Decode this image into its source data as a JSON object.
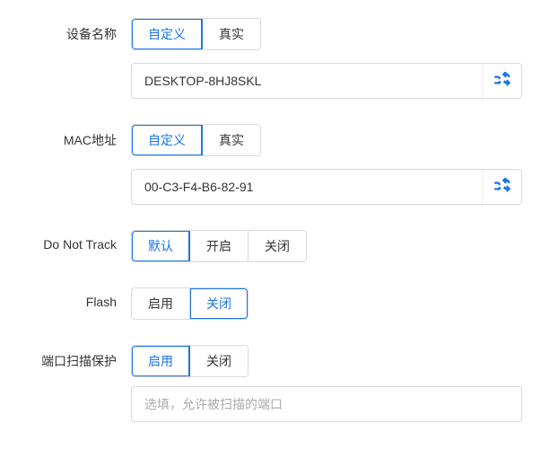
{
  "labels": {
    "device_name": "设备名称",
    "mac_address": "MAC地址",
    "dnt": "Do Not Track",
    "flash": "Flash",
    "port_scan": "端口扫描保护"
  },
  "toggles": {
    "custom": "自定义",
    "real": "真实",
    "default": "默认",
    "on": "开启",
    "off": "关闭",
    "enable": "启用",
    "disable": "关闭"
  },
  "inputs": {
    "device_name_value": "DESKTOP-8HJ8SKL",
    "mac_value": "00-C3-F4-B6-82-91",
    "port_placeholder": "选填，允许被扫描的端口"
  }
}
